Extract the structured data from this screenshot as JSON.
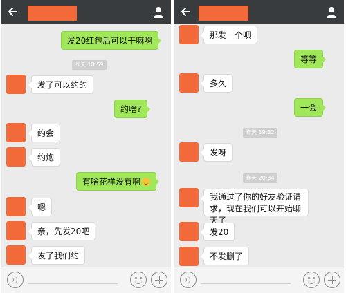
{
  "left": {
    "messages": [
      {
        "side": "out",
        "text": "发20红包后可以干嘛啊"
      },
      {
        "side": "time",
        "text": "昨天 18:59"
      },
      {
        "side": "in",
        "text": "发了可以约的"
      },
      {
        "side": "out",
        "text": "约啥?"
      },
      {
        "side": "in",
        "text": "约会"
      },
      {
        "side": "in",
        "text": "约炮"
      },
      {
        "side": "out",
        "text": "有啥花样没有啊",
        "emoji": "grin-emoji"
      },
      {
        "side": "in",
        "text": "嗯"
      },
      {
        "side": "in",
        "text": "亲，先发20吧"
      },
      {
        "side": "in",
        "text": "发了我们约"
      }
    ]
  },
  "right": {
    "messages": [
      {
        "side": "in",
        "text": "那发一个呗"
      },
      {
        "side": "out",
        "text": "等等"
      },
      {
        "side": "in",
        "text": "多久"
      },
      {
        "side": "out",
        "text": "一会"
      },
      {
        "side": "time",
        "text": "昨天 19:32"
      },
      {
        "side": "in",
        "text": "发呀"
      },
      {
        "side": "time",
        "text": "昨天 20:34"
      },
      {
        "side": "in",
        "text": "我通过了你的好友验证请求，现在我们可以开始聊天了"
      },
      {
        "side": "in",
        "text": "发20"
      },
      {
        "side": "in",
        "text": "不发删了"
      }
    ]
  },
  "icons": {
    "back": "back-arrow-icon",
    "contact": "person-icon",
    "voice": "voice-icon",
    "emoji": "smiley-icon",
    "more": "plus-icon"
  },
  "colors": {
    "header": "#383c3f",
    "outgoing_bubble": "#a0e75a",
    "incoming_bubble": "#ffffff",
    "chat_background": "#ebebeb",
    "redaction": "#f26a3a"
  }
}
